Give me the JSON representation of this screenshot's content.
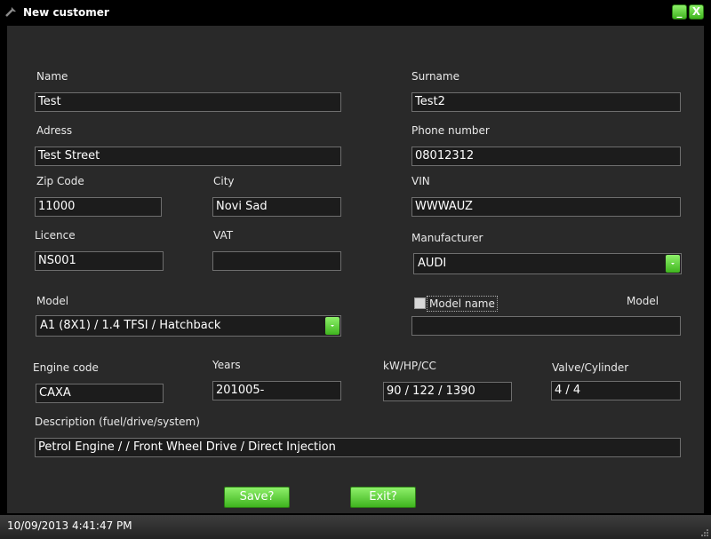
{
  "window": {
    "title": "New customer"
  },
  "labels": {
    "name": "Name",
    "surname": "Surname",
    "address": "Adress",
    "phone": "Phone number",
    "zip": "Zip Code",
    "city": "City",
    "vin": "VIN",
    "licence": "Licence",
    "vat": "VAT",
    "manufacturer": "Manufacturer",
    "model": "Model",
    "model_name_checkbox": "Model name",
    "model_right": "Model",
    "engine_code": "Engine code",
    "years": "Years",
    "power": "kW/HP/CC",
    "valve_cylinder": "Valve/Cylinder",
    "description": "Description (fuel/drive/system)"
  },
  "values": {
    "name": "Test",
    "surname": "Test2",
    "address": "Test Street",
    "phone": "08012312",
    "zip": "11000",
    "city": "Novi Sad",
    "vin": "WWWAUZ",
    "licence": "NS001",
    "vat": "",
    "manufacturer": "AUDI",
    "model": "A1 (8X1) / 1.4 TFSI / Hatchback",
    "model_name": "",
    "engine_code": "CAXA",
    "years": "201005-",
    "power": "90 / 122 / 1390",
    "valve_cylinder": "4 / 4",
    "description": "Petrol Engine /  / Front Wheel Drive / Direct Injection"
  },
  "buttons": {
    "save": "Save?",
    "exit": "Exit?",
    "minimize": "_",
    "close": "X"
  },
  "status": {
    "datetime": "10/09/2013 4:41:47 PM"
  },
  "checkbox": {
    "model_name_checked": false
  }
}
